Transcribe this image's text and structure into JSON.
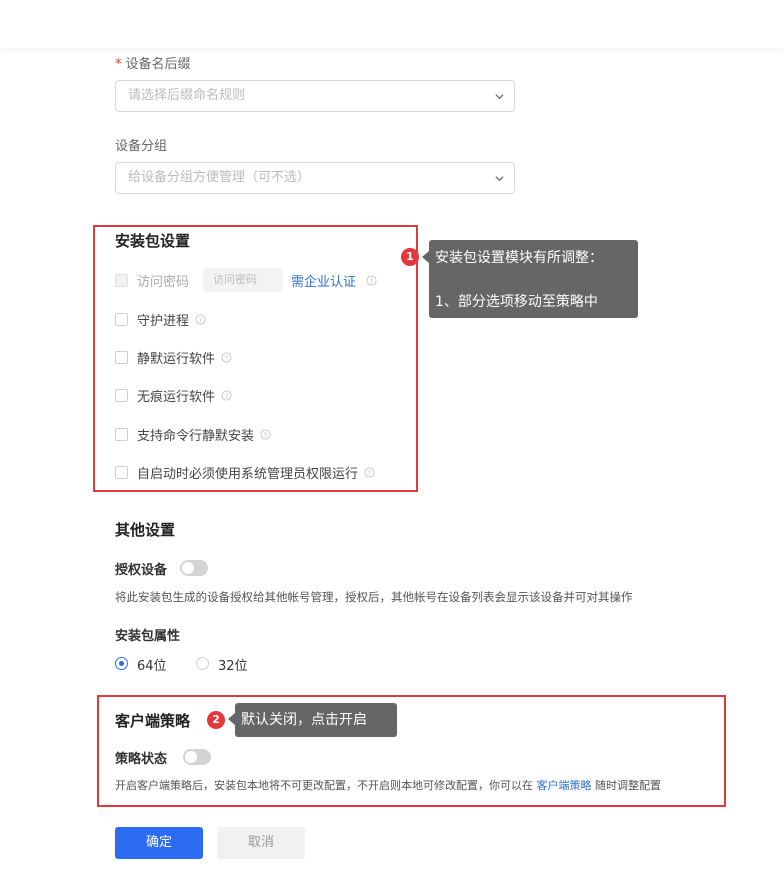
{
  "device_suffix": {
    "required_mark": "*",
    "label": "设备名后缀",
    "placeholder": "请选择后缀命名规则"
  },
  "device_group": {
    "label": "设备分组",
    "placeholder": "给设备分组方便管理（可不选）"
  },
  "package_settings": {
    "title": "安装包设置",
    "access_password": {
      "label": "访问密码",
      "input_placeholder": "访问密码",
      "link": "需企业认证"
    },
    "options": [
      {
        "label": "守护进程"
      },
      {
        "label": "静默运行软件"
      },
      {
        "label": "无痕运行软件"
      },
      {
        "label": "支持命令行静默安装"
      },
      {
        "label": "自启动时必须使用系统管理员权限运行"
      }
    ]
  },
  "annotation1": {
    "badge": "1",
    "line1": "安装包设置模块有所调整：",
    "line2": "1、部分选项移动至策略中"
  },
  "other_settings": {
    "title": "其他设置",
    "authorize_label": "授权设备",
    "authorize_desc": "将此安装包生成的设备授权给其他帐号管理，授权后，其他帐号在设备列表会显示该设备并可对其操作",
    "package_attr_label": "安装包属性",
    "bit64": "64位",
    "bit32": "32位"
  },
  "client_policy": {
    "title": "客户端策略",
    "status_label": "策略状态",
    "desc_before": "开启客户端策略后，安装包本地将不可更改配置，不开启则本地可修改配置，你可以在",
    "desc_link": "客户端策略",
    "desc_after": "随时调整配置"
  },
  "annotation2": {
    "badge": "2",
    "text": "默认关闭，点击开启"
  },
  "buttons": {
    "confirm": "确定",
    "cancel": "取消"
  },
  "colors": {
    "primary": "#2b6cf3",
    "highlight_border": "#e0393e",
    "tooltip_bg": "#666666",
    "link": "#2f6fd6"
  }
}
